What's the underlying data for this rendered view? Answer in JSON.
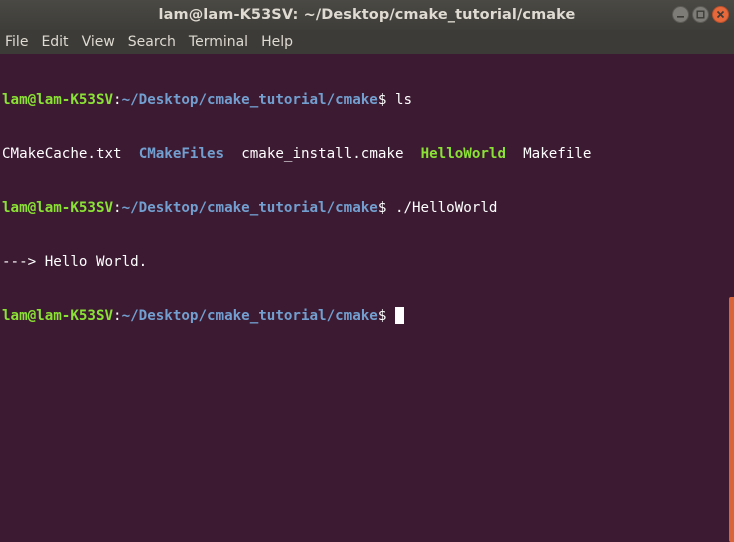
{
  "window": {
    "title": "lam@lam-K53SV: ~/Desktop/cmake_tutorial/cmake",
    "controls": {
      "minimize": "minimize-icon",
      "maximize": "maximize-icon",
      "close": "close-icon"
    }
  },
  "menu": {
    "items": [
      "File",
      "Edit",
      "View",
      "Search",
      "Terminal",
      "Help"
    ]
  },
  "terminal": {
    "prompt_user": "lam@lam-K53SV",
    "prompt_sep": ":",
    "prompt_path": "~/Desktop/cmake_tutorial/cmake",
    "prompt_end": "$ ",
    "lines": [
      {
        "type": "prompt",
        "command": "ls"
      },
      {
        "type": "ls",
        "entries": [
          {
            "name": "CMakeCache.txt",
            "kind": "file"
          },
          {
            "name": "CMakeFiles",
            "kind": "dir"
          },
          {
            "name": "cmake_install.cmake",
            "kind": "file"
          },
          {
            "name": "HelloWorld",
            "kind": "exe"
          },
          {
            "name": "Makefile",
            "kind": "file"
          }
        ]
      },
      {
        "type": "prompt",
        "command": "./HelloWorld"
      },
      {
        "type": "output",
        "text": "---> Hello World."
      },
      {
        "type": "prompt",
        "command": ""
      }
    ]
  },
  "colors": {
    "background": "#3c1a32",
    "user": "#8ae234",
    "path": "#729fcf",
    "executable": "#8ae234",
    "directory": "#729fcf",
    "scroll_thumb": "#d9643a"
  }
}
